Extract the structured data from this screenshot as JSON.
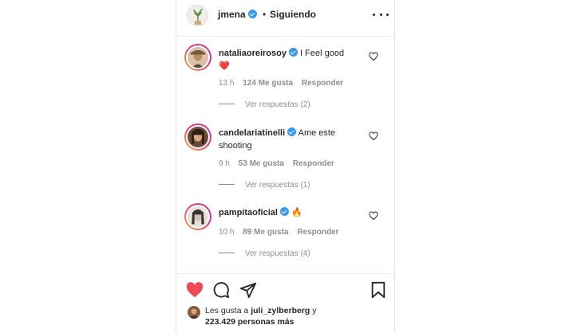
{
  "header": {
    "username": "jmena",
    "separator": "•",
    "follow_status": "Siguiendo"
  },
  "comments": [
    {
      "username": "nataliaoreirosoy",
      "text": "I Feel good",
      "emoji": "❤️",
      "time": "13 h",
      "likes": "124 Me gusta",
      "reply": "Responder",
      "view_replies": "Ver respuestas (2)"
    },
    {
      "username": "candelariatinelli",
      "text": "Ame este shooting",
      "emoji": "",
      "time": "9 h",
      "likes": "53 Me gusta",
      "reply": "Responder",
      "view_replies": "Ver respuestas (1)"
    },
    {
      "username": "pampitaoficial",
      "text": "",
      "emoji": "🔥",
      "time": "10 h",
      "likes": "89 Me gusta",
      "reply": "Responder",
      "view_replies": "Ver respuestas (4)"
    }
  ],
  "likes_summary": {
    "prefix": "Les gusta a",
    "user": "juli_zylberberg",
    "suffix": "y",
    "count": "223.429 personas más"
  },
  "icons": {
    "like": "heart-filled-icon",
    "comment": "comment-bubble-icon",
    "share": "paper-plane-icon",
    "save": "bookmark-icon",
    "more": "more-dots-icon",
    "verified": "verified-badge-icon"
  },
  "colors": {
    "like_red": "#ed4956",
    "verified_blue": "#3897f0",
    "secondary_text": "#8e8e8e"
  }
}
